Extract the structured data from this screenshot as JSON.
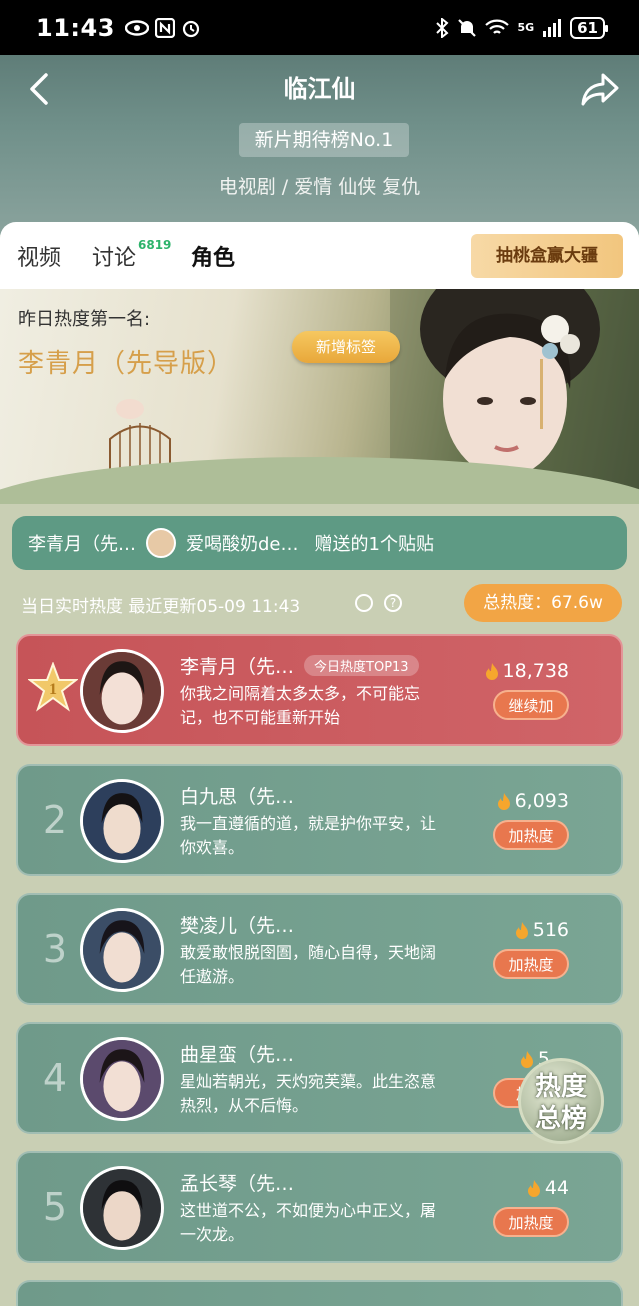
{
  "status_bar": {
    "time": "11:43",
    "battery": "61",
    "network": "5G"
  },
  "header": {
    "title": "临江仙",
    "rank_badge": "新片期待榜No.1",
    "genres": "电视剧 / 爱情 仙侠 复仇"
  },
  "tabs": {
    "items": [
      {
        "label": "视频"
      },
      {
        "label": "讨论"
      },
      {
        "label": "角色"
      }
    ],
    "discuss_count": "6819",
    "promo": "抽桃盒赢大疆"
  },
  "hero": {
    "subtitle": "昨日热度第一名:",
    "name": "李青月（先导版）",
    "new_tag": "新增标签"
  },
  "gift_bar": {
    "character": "李青月（先…",
    "user": "爱喝酸奶de…",
    "text": "赠送的1个贴贴"
  },
  "heat": {
    "label": "当日实时热度 最近更新05-09 11:43",
    "total": "总热度：67.6w"
  },
  "characters": [
    {
      "rank": "1",
      "name": "李青月（先…",
      "tag": "今日热度TOP13",
      "quote": "你我之间隔着太多太多，不可能忘记，也不可能重新开始",
      "heat": "18,738",
      "button": "继续加"
    },
    {
      "rank": "2",
      "name": "白九思（先…",
      "tag": "",
      "quote": "我一直遵循的道，就是护你平安，让你欢喜。",
      "heat": "6,093",
      "button": "加热度"
    },
    {
      "rank": "3",
      "name": "樊凌儿（先…",
      "tag": "",
      "quote": "敢爱敢恨脱囹圄，随心自得，天地阔任遨游。",
      "heat": "516",
      "button": "加热度"
    },
    {
      "rank": "4",
      "name": "曲星蛮（先…",
      "tag": "",
      "quote": "星灿若朝光，天灼宛芙蕖。此生恣意热烈，从不后悔。",
      "heat": "5…",
      "button": "加…"
    },
    {
      "rank": "5",
      "name": "孟长琴（先…",
      "tag": "",
      "quote": "这世道不公，不如便为心中正义，屠一次龙。",
      "heat": "44",
      "button": "加热度"
    }
  ],
  "float_badge": {
    "line1": "热度",
    "line2": "总榜"
  },
  "colors": {
    "accent_gold": "#d69f4a",
    "first_card": "#c65458",
    "card_green": "#6f9a8a",
    "heat_button": "#e8774e"
  }
}
